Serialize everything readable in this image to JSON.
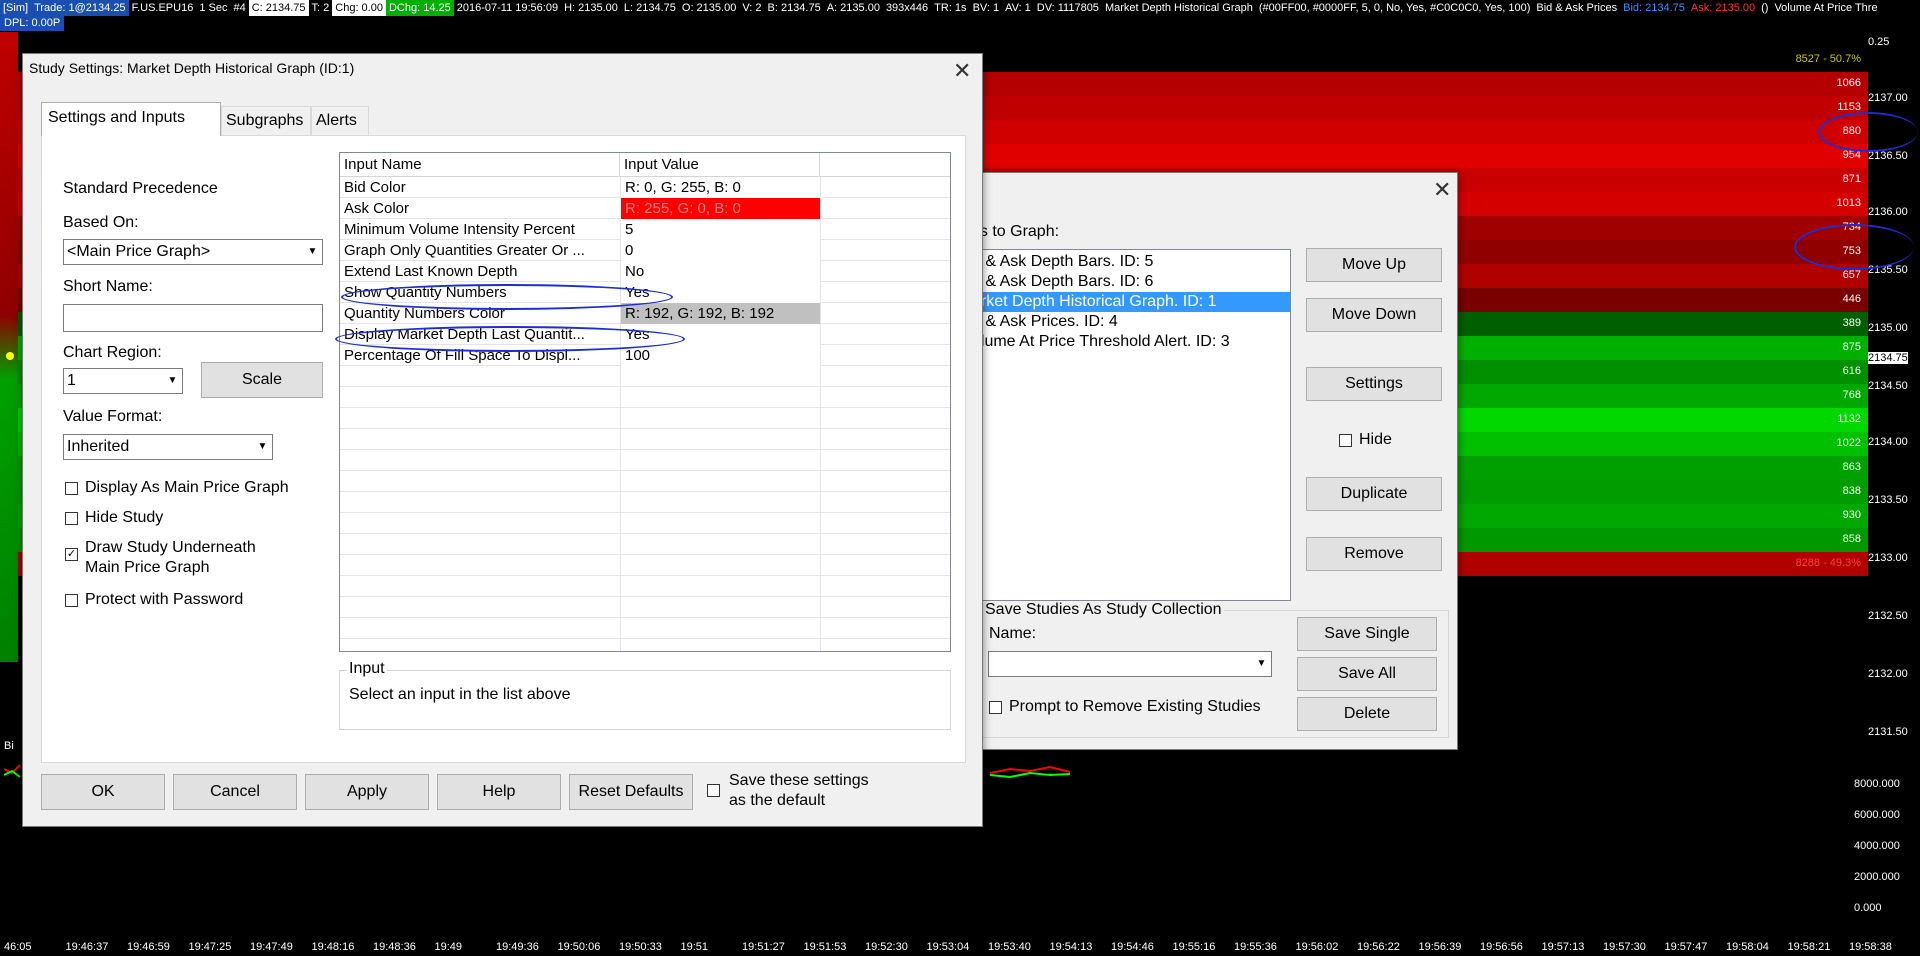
{
  "topbar": {
    "items": [
      "[Sim]",
      "Trade: 1@2134.25",
      "F.US.EPU16",
      "1 Sec",
      "#4",
      "C: 2134.75",
      "T: 2",
      "Chg: 0.00",
      "DChg: 14.25",
      "2016-07-11 19:56:09",
      "H: 2135.00",
      "L: 2134.75",
      "O: 2135.00",
      "V: 2",
      "B: 2134.75",
      "A: 2135.00",
      "393x446",
      "TR: 1s",
      "BV: 1",
      "AV: 1",
      "DV: 1117805",
      "Market Depth Historical Graph",
      "(#00FF00, #0000FF, 5, 0, No, Yes, #C0C0C0, Yes, 100)",
      "Bid & Ask Prices",
      "Bid: 2134.75",
      "Ask: 2135.00",
      "()",
      "Volume At Price Thre"
    ],
    "dpl": "DPL: 0.00P"
  },
  "ladder": {
    "rows": [
      {
        "qty": "8527 - 50.7%",
        "color": "#c8c800"
      },
      {
        "qty": "1066",
        "color": "#b40000"
      },
      {
        "qty": "1153",
        "color": "#c00000"
      },
      {
        "qty": "880",
        "color": "#d00000"
      },
      {
        "qty": "954",
        "color": "#e00000"
      },
      {
        "qty": "871",
        "color": "#c80000"
      },
      {
        "qty": "1013",
        "color": "#d40000"
      },
      {
        "qty": "734",
        "color": "#a00000"
      },
      {
        "qty": "753",
        "color": "#900000"
      },
      {
        "qty": "657",
        "color": "#b00000"
      },
      {
        "qty": "446",
        "color": "#7a0000"
      },
      {
        "qty": "389",
        "color": "#006000"
      },
      {
        "qty": "875",
        "color": "#00b000"
      },
      {
        "qty": "616",
        "color": "#009000"
      },
      {
        "qty": "768",
        "color": "#00a800"
      },
      {
        "qty": "1132",
        "color": "#00d800"
      },
      {
        "qty": "1022",
        "color": "#00c000"
      },
      {
        "qty": "863",
        "color": "#00a000"
      },
      {
        "qty": "838",
        "color": "#009c00"
      },
      {
        "qty": "930",
        "color": "#00a800"
      },
      {
        "qty": "858",
        "color": "#009800"
      },
      {
        "qty": "8288 - 49.3%",
        "color": "#b00000"
      }
    ],
    "prices": [
      "0.25",
      "2137.00",
      "2136.50",
      "2136.00",
      "2135.50",
      "2135.00",
      "2134.75",
      "2134.50",
      "2134.00",
      "2133.50",
      "2133.00",
      "2132.50",
      "2132.00",
      "2131.50"
    ],
    "volumes": [
      "8000.000",
      "6000.000",
      "4000.000",
      "2000.000",
      "0.000"
    ]
  },
  "timeaxis": [
    "46:05",
    "19:46:37",
    "19:46:59",
    "19:47:25",
    "19:47:49",
    "19:48:16",
    "19:48:36",
    "19:49",
    "19:49:36",
    "19:50:06",
    "19:50:33",
    "19:51",
    "19:51:27",
    "19:51:53",
    "19:52:30",
    "19:53:04",
    "19:53:40",
    "19:54:13",
    "19:54:46",
    "19:55:16",
    "19:55:36",
    "19:56:02",
    "19:56:22",
    "19:56:39",
    "19:56:56",
    "19:57:13",
    "19:57:30",
    "19:57:47",
    "19:58:04",
    "19:58:21",
    "19:58:38"
  ],
  "studies_dialog": {
    "header": "es to Graph:",
    "list": [
      "d & Ask Depth Bars. ID: 5",
      "d & Ask Depth Bars. ID: 6",
      "arket Depth Historical Graph. ID: 1",
      "d & Ask Prices. ID: 4",
      "olume At Price Threshold Alert. ID: 3"
    ],
    "selected_index": 2,
    "buttons": {
      "move_up": "Move Up",
      "move_down": "Move Down",
      "settings": "Settings",
      "hide": "Hide",
      "duplicate": "Duplicate",
      "remove": "Remove"
    },
    "collection": {
      "group": "Save Studies As Study Collection",
      "name_label": "Name:",
      "save_single": "Save Single",
      "save_all": "Save All",
      "delete": "Delete",
      "prompt": "Prompt to Remove Existing Studies"
    }
  },
  "settings_dialog": {
    "title": "Study Settings: Market Depth Historical Graph (ID:1)",
    "tabs": [
      "Settings and Inputs",
      "Subgraphs",
      "Alerts"
    ],
    "precedence": "Standard Precedence",
    "based_on_label": "Based On:",
    "based_on_value": "<Main Price Graph>",
    "short_name_label": "Short Name:",
    "short_name_value": "",
    "chart_region_label": "Chart Region:",
    "chart_region_value": "1",
    "scale_button": "Scale",
    "value_format_label": "Value Format:",
    "value_format_value": "Inherited",
    "checkboxes": [
      {
        "label": "Display As Main Price Graph",
        "checked": false
      },
      {
        "label": "Hide Study",
        "checked": false
      },
      {
        "label": "Draw Study Underneath",
        "label2": "Main Price Graph",
        "checked": true
      },
      {
        "label": "Protect with Password",
        "checked": false
      }
    ],
    "grid_headers": [
      "Input Name",
      "Input Value"
    ],
    "inputs": [
      {
        "name": "Bid Color",
        "value": "R: 0, G: 255, B: 0",
        "bg": "#ffffff",
        "fg": "#000000"
      },
      {
        "name": "Ask Color",
        "value": "R: 255, G: 0, B: 0",
        "bg": "#ff0000",
        "fg": "#ff0000"
      },
      {
        "name": "Minimum Volume Intensity Percent",
        "value": "5",
        "bg": "#ffffff",
        "fg": "#000000"
      },
      {
        "name": "Graph Only Quantities Greater Or ...",
        "value": "0",
        "bg": "#ffffff",
        "fg": "#000000"
      },
      {
        "name": "Extend Last Known Depth",
        "value": "No",
        "bg": "#ffffff",
        "fg": "#000000"
      },
      {
        "name": "Show Quantity Numbers",
        "value": "Yes",
        "bg": "#ffffff",
        "fg": "#000000"
      },
      {
        "name": "Quantity Numbers Color",
        "value": "R: 192, G: 192, B: 192",
        "bg": "#c0c0c0",
        "fg": "#000000"
      },
      {
        "name": "Display Market Depth Last Quantit...",
        "value": "Yes",
        "bg": "#ffffff",
        "fg": "#000000"
      },
      {
        "name": "Percentage Of Fill Space To Displ...",
        "value": "100",
        "bg": "#ffffff",
        "fg": "#000000"
      }
    ],
    "input_group": "Input",
    "input_help": "Select an input in the list above",
    "buttons": {
      "ok": "OK",
      "cancel": "Cancel",
      "apply": "Apply",
      "help": "Help",
      "reset": "Reset Defaults"
    },
    "save_default": "Save these settings",
    "save_default2": "as the default"
  },
  "colors": {
    "bid": "#00ff00",
    "ask": "#ff0000",
    "annotation": "#1c2fd4",
    "selection": "#3399ff"
  }
}
